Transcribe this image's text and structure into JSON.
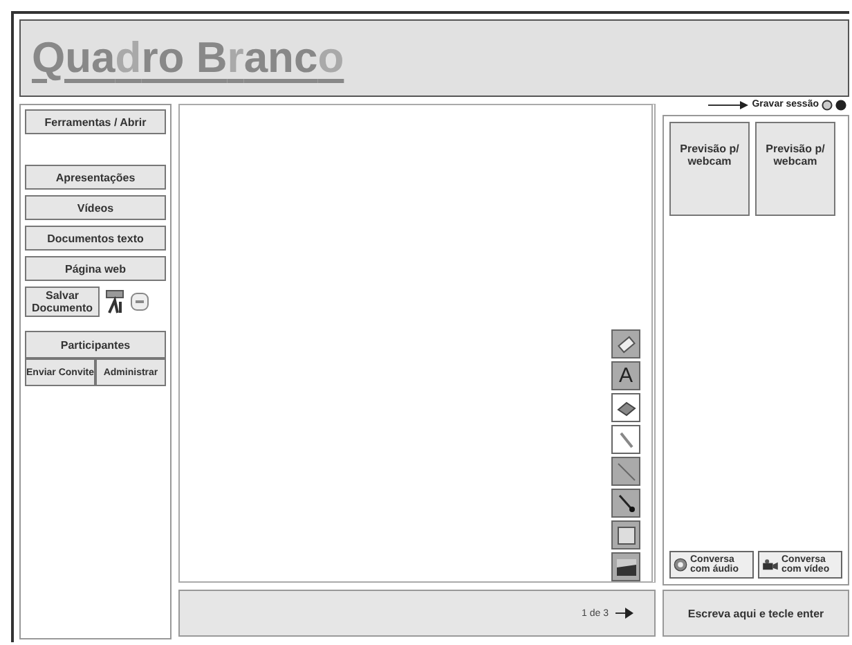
{
  "title": {
    "parts": [
      {
        "text": "Qua",
        "faded": false
      },
      {
        "text": "d",
        "faded": true
      },
      {
        "text": "ro B",
        "faded": false
      },
      {
        "text": "r",
        "faded": true
      },
      {
        "text": "anc",
        "faded": false
      },
      {
        "text": "o",
        "faded": true
      }
    ]
  },
  "sidebar": {
    "tools_button": "Ferramentas / Abrir",
    "media_buttons": [
      "Apresentações",
      "Vídeos",
      "Documentos texto",
      "Página web"
    ],
    "save_button": "Salvar Documento",
    "participants": "Participantes",
    "participant_actions": [
      "Enviar Convite",
      "Administrar"
    ]
  },
  "toolbar": [
    {
      "kind": "eraser",
      "selected": false
    },
    {
      "kind": "text",
      "label": "A",
      "selected": false
    },
    {
      "kind": "fill",
      "selected": true
    },
    {
      "kind": "pen",
      "selected": true
    },
    {
      "kind": "line",
      "selected": false
    },
    {
      "kind": "arrow",
      "selected": false
    },
    {
      "kind": "rectangle",
      "selected": false
    },
    {
      "kind": "image",
      "selected": false
    }
  ],
  "pager": "1 de 3",
  "record": "Gravar sessão",
  "webcams": [
    "Previsão p/ webcam",
    "Previsão p/ webcam"
  ],
  "chat_buttons": [
    {
      "kind": "audio",
      "label": "Conversa com áudio"
    },
    {
      "kind": "video",
      "label": "Conversa com vídeo"
    }
  ],
  "chat_input": {
    "placeholder": "Escreva aqui e tecle enter"
  }
}
